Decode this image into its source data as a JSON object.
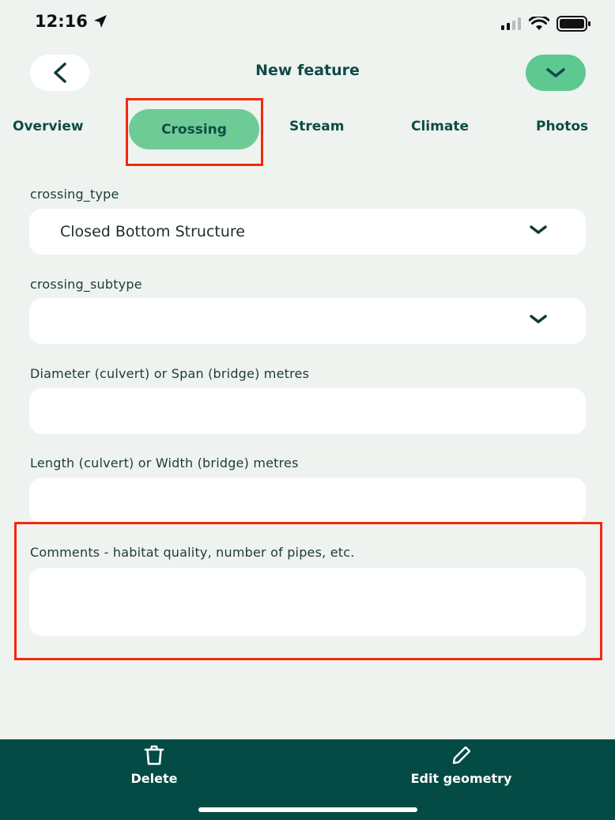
{
  "status_bar": {
    "time": "12:16"
  },
  "header": {
    "title": "New feature",
    "back_icon": "chevron-left-icon",
    "confirm_icon": "check-chevron-icon"
  },
  "tabs": [
    {
      "label": "Overview",
      "active": false
    },
    {
      "label": "Crossing",
      "active": true
    },
    {
      "label": "Stream",
      "active": false
    },
    {
      "label": "Climate",
      "active": false
    },
    {
      "label": "Photos",
      "active": false
    }
  ],
  "form": {
    "crossing_type": {
      "label": "crossing_type",
      "value": "Closed Bottom Structure"
    },
    "crossing_subtype": {
      "label": "crossing_subtype",
      "value": ""
    },
    "diameter": {
      "label": "Diameter (culvert) or Span (bridge) metres",
      "value": ""
    },
    "length": {
      "label": "Length (culvert) or Width (bridge) metres",
      "value": ""
    },
    "comments": {
      "label": "Comments - habitat quality,  number of pipes,  etc.",
      "value": ""
    }
  },
  "bottom_bar": {
    "delete_label": "Delete",
    "edit_geometry_label": "Edit geometry"
  },
  "colors": {
    "background": "#eef3f0",
    "accent_green": "#6fcb95",
    "dark_teal": "#034b44",
    "highlight_red": "#f2290f"
  }
}
